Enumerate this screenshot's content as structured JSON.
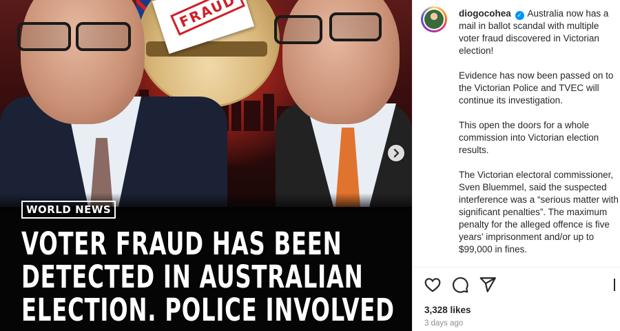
{
  "post": {
    "image": {
      "tag": "WORLD NEWS",
      "stamp_text": "FRAUD",
      "headline_lines": [
        "VOTER FRAUD HAS BEEN",
        "DETECTED IN AUSTRALIAN",
        "ELECTION. POLICE INVOLVED"
      ],
      "next_icon": "chevron-right-icon"
    },
    "author": {
      "username": "diogocohea",
      "verified_icon": "verified-badge-icon"
    },
    "caption": [
      "Australia now has a mail in ballot scandal with multiple voter fraud discovered in Victorian election!",
      "Evidence has now been passed on to the Victorian Police and TVEC will continue its investigation.",
      "This open the doors for a whole commission into Victorian election results.",
      "The Victorian electoral commissioner, Sven Bluemmel, said the suspected interference was a “serious matter with significant penalties”. The maximum penalty for the alleged offence is five years’ imprisonment and/or up to $99,000 in fines."
    ],
    "actions": {
      "like_icon": "heart-icon",
      "comment_icon": "comment-icon",
      "share_icon": "send-icon",
      "save_icon": "bookmark-icon"
    },
    "likes": "3,328 likes",
    "age": "3 days ago"
  },
  "colors": {
    "accent_blue": "#0095f6",
    "stamp_red": "#d01f25",
    "text_primary": "#262626",
    "text_secondary": "#8e8e8e"
  }
}
